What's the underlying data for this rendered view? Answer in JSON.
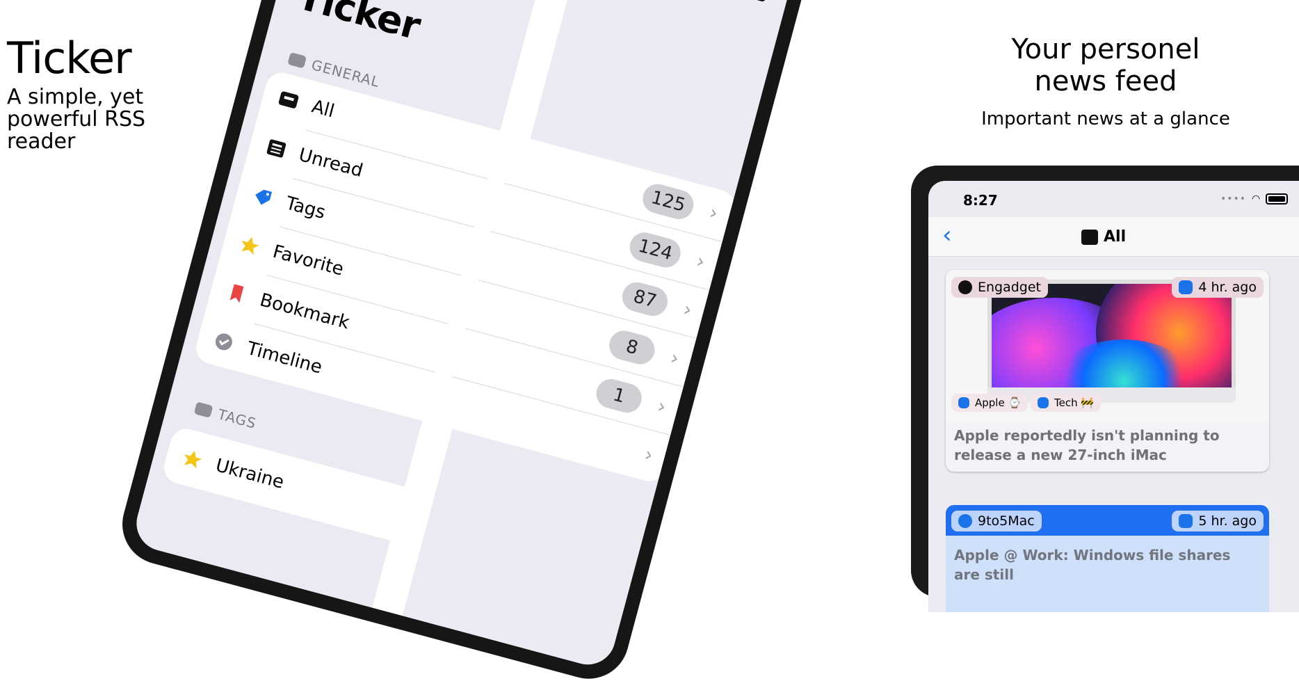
{
  "promo_left": {
    "title": "Ticker",
    "subtitle": "A simple, yet powerful RSS reader"
  },
  "promo_right": {
    "title_line1": "Your personel",
    "title_line2": "news feed",
    "subtitle": "Important news at a glance"
  },
  "left_ipad": {
    "app_title": "Ticker",
    "general_header": "GENERAL",
    "tags_header": "TAGS",
    "items": [
      {
        "label": "All",
        "icon": "tray-icon",
        "count": "125"
      },
      {
        "label": "Unread",
        "icon": "newspaper-icon",
        "count": "124"
      },
      {
        "label": "Tags",
        "icon": "tag-icon",
        "count": "87"
      },
      {
        "label": "Favorite",
        "icon": "star-icon",
        "count": "8"
      },
      {
        "label": "Bookmark",
        "icon": "bookmark-icon",
        "count": "1"
      },
      {
        "label": "Timeline",
        "icon": "checkmark-seal-icon",
        "count": ""
      }
    ],
    "tag_items": [
      {
        "label": "Ukraine"
      }
    ]
  },
  "right_ipad": {
    "status_time": "8:27",
    "nav_title": "All",
    "back_icon": "chevron-left-icon",
    "articles": [
      {
        "source": "Engadget",
        "time_ago": "4 hr. ago",
        "tags": [
          "Apple ⌚",
          "Tech 🚧"
        ],
        "headline": "Apple reportedly isn't planning to release a new 27-inch iMac"
      },
      {
        "source": "9to5Mac",
        "time_ago": "5 hr. ago",
        "headline": "Apple @ Work: Windows file shares are still"
      }
    ]
  },
  "colors": {
    "accent": "#1a73e8",
    "badge_bg": "#cfcfd4",
    "card2_header": "#1f6ff0"
  }
}
